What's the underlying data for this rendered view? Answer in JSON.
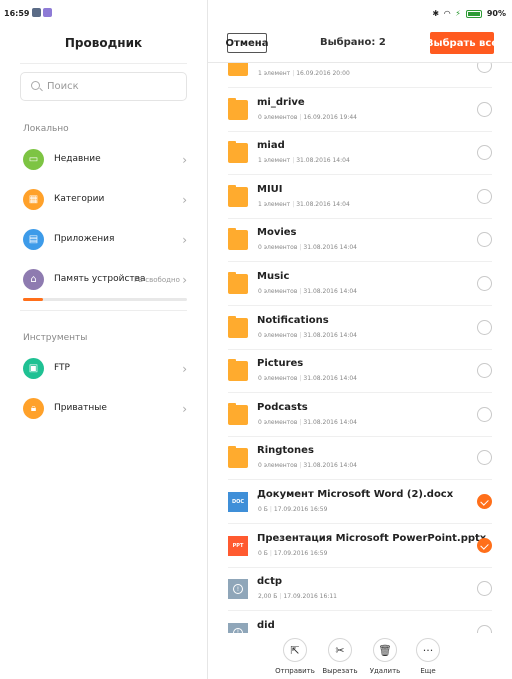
{
  "status_bar": {
    "time": "16:59",
    "battery": "90%"
  },
  "sidebar": {
    "title": "Проводник",
    "search_placeholder": "Поиск",
    "local_label": "Локально",
    "tools_label": "Инструменты",
    "local_items": [
      {
        "label": "Недавние",
        "icon": "folder-icon",
        "color": "#7dc443"
      },
      {
        "label": "Категории",
        "icon": "grid-icon",
        "color": "#ffa12a"
      },
      {
        "label": "Приложения",
        "icon": "apps-icon",
        "color": "#3d9be9"
      },
      {
        "label": "Память устройства",
        "sub": "ГБ свободно",
        "icon": "home-icon",
        "color": "#8e7bb0"
      }
    ],
    "storage_used": 0.12,
    "tool_items": [
      {
        "label": "FTP",
        "icon": "ftp-icon",
        "color": "#1fc193"
      },
      {
        "label": "Приватные",
        "icon": "lock-icon",
        "color": "#ffa12a"
      }
    ]
  },
  "header": {
    "cancel": "Отмена",
    "selected": "Выбрано: 2",
    "select_all": "Выбрать все"
  },
  "files": [
    {
      "name": "",
      "meta_count": "1 элемент",
      "meta_date": "16.09.2016 20:00",
      "type": "folder",
      "checked": false
    },
    {
      "name": "mi_drive",
      "meta_count": "0 элементов",
      "meta_date": "16.09.2016 19:44",
      "type": "folder",
      "checked": false
    },
    {
      "name": "miad",
      "meta_count": "1 элемент",
      "meta_date": "31.08.2016 14:04",
      "type": "folder",
      "checked": false
    },
    {
      "name": "MIUI",
      "meta_count": "1 элемент",
      "meta_date": "31.08.2016 14:04",
      "type": "folder",
      "checked": false
    },
    {
      "name": "Movies",
      "meta_count": "0 элементов",
      "meta_date": "31.08.2016 14:04",
      "type": "folder",
      "checked": false
    },
    {
      "name": "Music",
      "meta_count": "0 элементов",
      "meta_date": "31.08.2016 14:04",
      "type": "folder",
      "checked": false
    },
    {
      "name": "Notifications",
      "meta_count": "0 элементов",
      "meta_date": "31.08.2016 14:04",
      "type": "folder",
      "checked": false
    },
    {
      "name": "Pictures",
      "meta_count": "0 элементов",
      "meta_date": "31.08.2016 14:04",
      "type": "folder",
      "checked": false
    },
    {
      "name": "Podcasts",
      "meta_count": "0 элементов",
      "meta_date": "31.08.2016 14:04",
      "type": "folder",
      "checked": false
    },
    {
      "name": "Ringtones",
      "meta_count": "0 элементов",
      "meta_date": "31.08.2016 14:04",
      "type": "folder",
      "checked": false
    },
    {
      "name": "Документ Microsoft Word (2).docx",
      "meta_count": "0 Б",
      "meta_date": "17.09.2016 16:59",
      "type": "doc",
      "icon_text": "DOC",
      "checked": true
    },
    {
      "name": "Презентация Microsoft PowerPoint.pptx",
      "meta_count": "0 Б",
      "meta_date": "17.09.2016 16:59",
      "type": "ppt",
      "icon_text": "PPT",
      "checked": true
    },
    {
      "name": "dctp",
      "meta_count": "2,00 Б",
      "meta_date": "17.09.2016 16:11",
      "type": "unknown",
      "checked": false
    },
    {
      "name": "did",
      "meta_count": "",
      "meta_date": "",
      "type": "unknown",
      "checked": false
    }
  ],
  "toolbar": [
    {
      "label": "Отправить",
      "icon": "share-icon",
      "glyph": "⇱"
    },
    {
      "label": "Вырезать",
      "icon": "scissors-icon",
      "glyph": "✂"
    },
    {
      "label": "Удалить",
      "icon": "trash-icon",
      "glyph": "🗑"
    },
    {
      "label": "Еще",
      "icon": "more-icon",
      "glyph": "···"
    }
  ]
}
